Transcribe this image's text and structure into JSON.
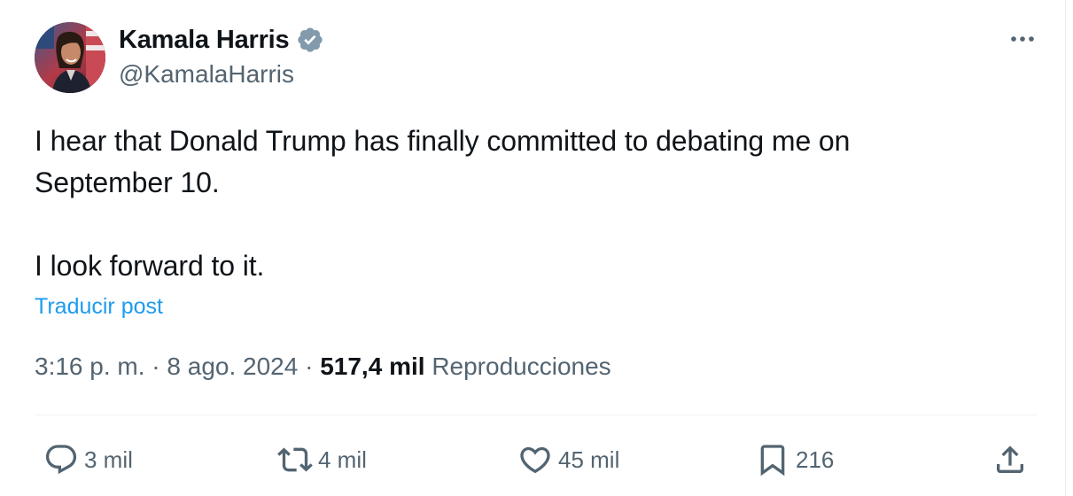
{
  "author": {
    "display_name": "Kamala Harris",
    "handle": "@KamalaHarris",
    "verified_icon": "verified-badge-icon",
    "avatar_icon": "avatar-photo"
  },
  "tweet": {
    "line1": "I hear that Donald Trump has finally committed to debating me on",
    "line2": "September 10.",
    "line3": "I look forward to it.",
    "translate_label": "Traducir post"
  },
  "meta": {
    "time": "3:16 p. m.",
    "sep1": "·",
    "date": "8 ago. 2024",
    "sep2": "·",
    "views_count": "517,4 mil",
    "views_label": "Reproducciones"
  },
  "actions": {
    "replies": "3 mil",
    "reposts": "4 mil",
    "likes": "45 mil",
    "bookmarks": "216"
  },
  "colors": {
    "link": "#1d9bf0",
    "muted": "#536471",
    "text": "#0f1419",
    "verified": "#829aab"
  }
}
